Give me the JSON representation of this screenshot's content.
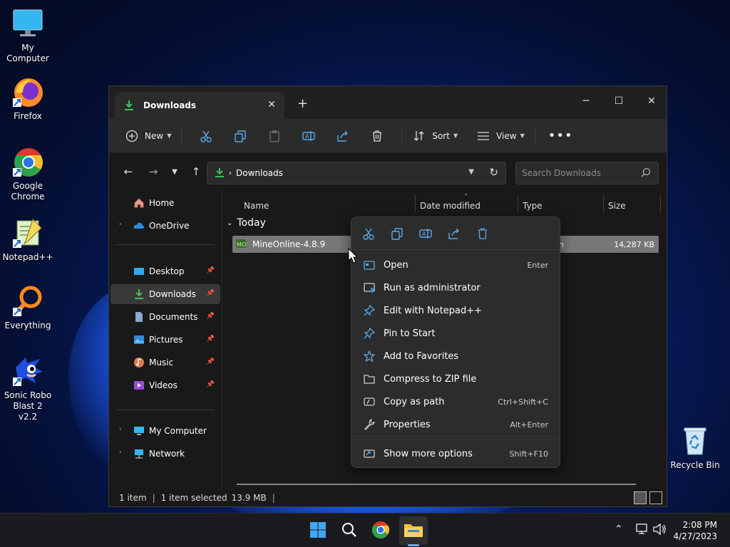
{
  "desktop": {
    "icons": [
      {
        "label": "My Computer",
        "icon": "monitor-icon"
      },
      {
        "label": "Firefox",
        "icon": "firefox-icon"
      },
      {
        "label": "Google Chrome",
        "icon": "chrome-icon"
      },
      {
        "label": "Notepad++",
        "icon": "notepadpp-icon"
      },
      {
        "label": "Everything",
        "icon": "search-magnifier-icon"
      },
      {
        "label": "Sonic Robo Blast 2 v2.2",
        "icon": "sonic-icon"
      }
    ],
    "recycle_bin": "Recycle Bin"
  },
  "window": {
    "tab_title": "Downloads",
    "toolbar": {
      "new_label": "New",
      "sort_label": "Sort",
      "view_label": "View"
    },
    "address": "Downloads",
    "search_placeholder": "Search Downloads",
    "sidebar": {
      "home": "Home",
      "onedrive": "OneDrive",
      "quick": [
        "Desktop",
        "Downloads",
        "Documents",
        "Pictures",
        "Music",
        "Videos"
      ],
      "my_computer": "My Computer",
      "network": "Network"
    },
    "columns": {
      "name": "Name",
      "date": "Date modified",
      "type": "Type",
      "size": "Size"
    },
    "group": "Today",
    "file": {
      "name": "MineOnline-4.8.9",
      "type_partial": "n",
      "size": "14,287 KB"
    },
    "status": {
      "count": "1 item",
      "selected": "1 item selected",
      "size": "13.9 MB"
    }
  },
  "context_menu": {
    "items": [
      {
        "label": "Open",
        "shortcut": "Enter",
        "icon": "open-icon"
      },
      {
        "label": "Run as administrator",
        "shortcut": "",
        "icon": "shield-icon"
      },
      {
        "label": "Edit with Notepad++",
        "shortcut": "",
        "icon": "pin-icon"
      },
      {
        "label": "Pin to Start",
        "shortcut": "",
        "icon": "pin-icon"
      },
      {
        "label": "Add to Favorites",
        "shortcut": "",
        "icon": "star-icon"
      },
      {
        "label": "Compress to ZIP file",
        "shortcut": "",
        "icon": "zip-icon"
      },
      {
        "label": "Copy as path",
        "shortcut": "Ctrl+Shift+C",
        "icon": "path-icon"
      },
      {
        "label": "Properties",
        "shortcut": "Alt+Enter",
        "icon": "wrench-icon"
      },
      {
        "label": "Show more options",
        "shortcut": "Shift+F10",
        "icon": "more-options-icon"
      }
    ]
  },
  "taskbar": {
    "time": "2:08 PM",
    "date": "4/27/2023"
  },
  "colors": {
    "accent": "#4cc2ff",
    "downloads_green": "#3fbf5f"
  }
}
